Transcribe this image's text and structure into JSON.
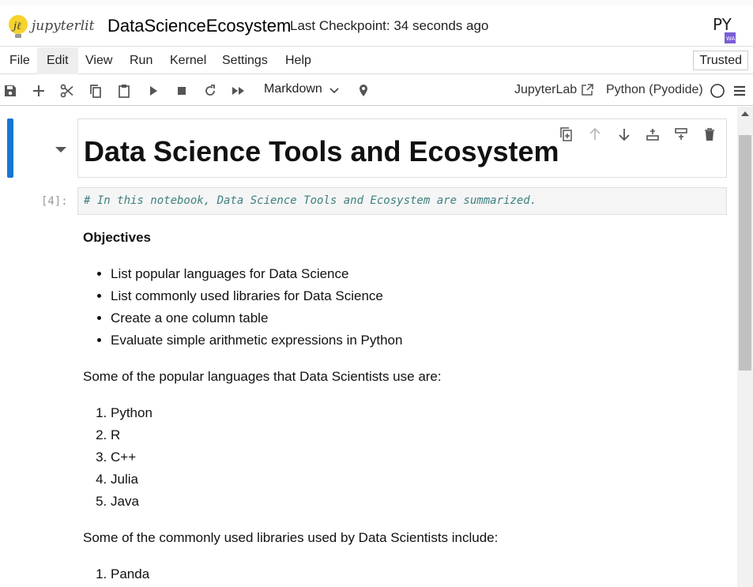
{
  "header": {
    "logo_text": "jupyterlite",
    "notebook_title": "DataScienceEcosystem",
    "checkpoint": "Last Checkpoint: 34 seconds ago",
    "pyodide_text": "PY",
    "pyodide_badge": "WA"
  },
  "menu": {
    "items": [
      "File",
      "Edit",
      "View",
      "Run",
      "Kernel",
      "Settings",
      "Help"
    ],
    "active": "Edit",
    "trusted": "Trusted"
  },
  "toolbar": {
    "cell_type": "Markdown",
    "jupyterlab": "JupyterLab",
    "kernel": "Python (Pyodide)"
  },
  "cells": {
    "heading": "Data Science Tools and Ecosystem",
    "prompt": "[4]:",
    "code_comment": "# In this notebook, Data Science Tools and Ecosystem are summarized.",
    "objectives_title": "Objectives",
    "objectives": [
      "List popular languages for Data Science",
      "List commonly used libraries for Data Science",
      "Create a one column table",
      "Evaluate simple arithmetic expressions in Python"
    ],
    "languages_intro": "Some of the popular languages that Data Scientists use are:",
    "languages": [
      "Python",
      "R",
      "C++",
      "Julia",
      "Java"
    ],
    "libraries_intro": "Some of the commonly used libraries used by Data Scientists include:",
    "libraries": [
      "Panda"
    ]
  },
  "colors": {
    "active_cell": "#1976d2",
    "code_comment": "#408080"
  }
}
